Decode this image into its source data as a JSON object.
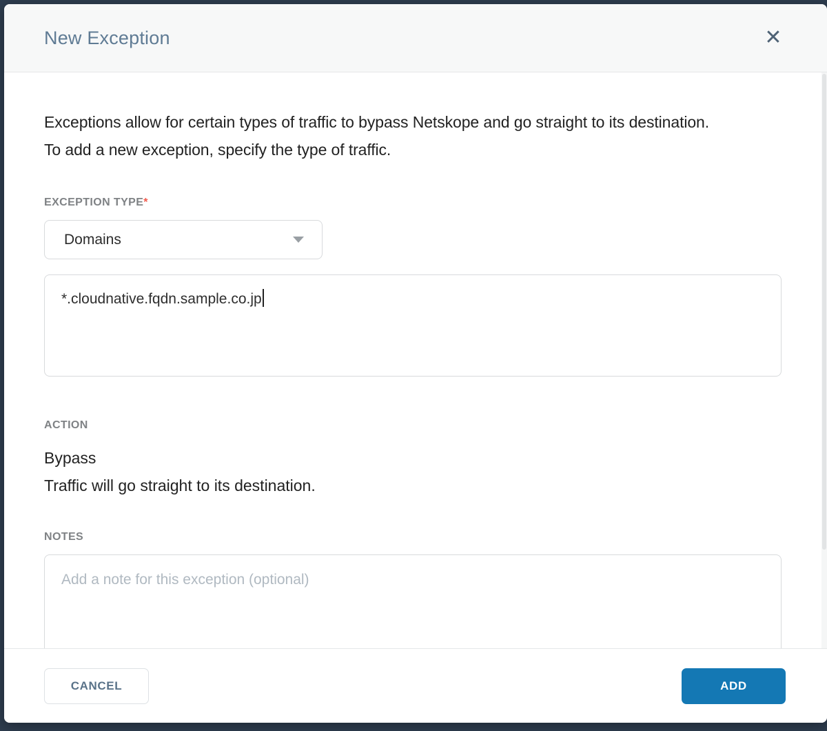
{
  "modal": {
    "title": "New Exception",
    "close_icon": "✕",
    "description": "Exceptions allow for certain types of traffic to bypass Netskope and go straight to its destination. To add a new exception, specify the type of traffic.",
    "exception_type": {
      "label": "EXCEPTION TYPE",
      "required_marker": "*",
      "selected_option": "Domains",
      "dropdown_icon": "caret-down"
    },
    "domains_input": {
      "value": "*.cloudnative.fqdn.sample.co.jp"
    },
    "action": {
      "label": "ACTION",
      "value": "Bypass",
      "description": "Traffic will go straight to its destination."
    },
    "notes": {
      "label": "NOTES",
      "placeholder": "Add a note for this exception (optional)"
    },
    "footer": {
      "cancel_label": "CANCEL",
      "add_label": "ADD"
    }
  },
  "colors": {
    "backdrop": "#2e3d4f",
    "header_background": "#f7f8f8",
    "title_text": "#5f7b94",
    "body_text": "#222222",
    "label_text": "#7f8285",
    "required_asterisk": "#f15b4d",
    "input_border": "#d8dadc",
    "placeholder_text": "#b0b9c1",
    "primary_button": "#1478b4",
    "cancel_button_text": "#5a7389"
  }
}
